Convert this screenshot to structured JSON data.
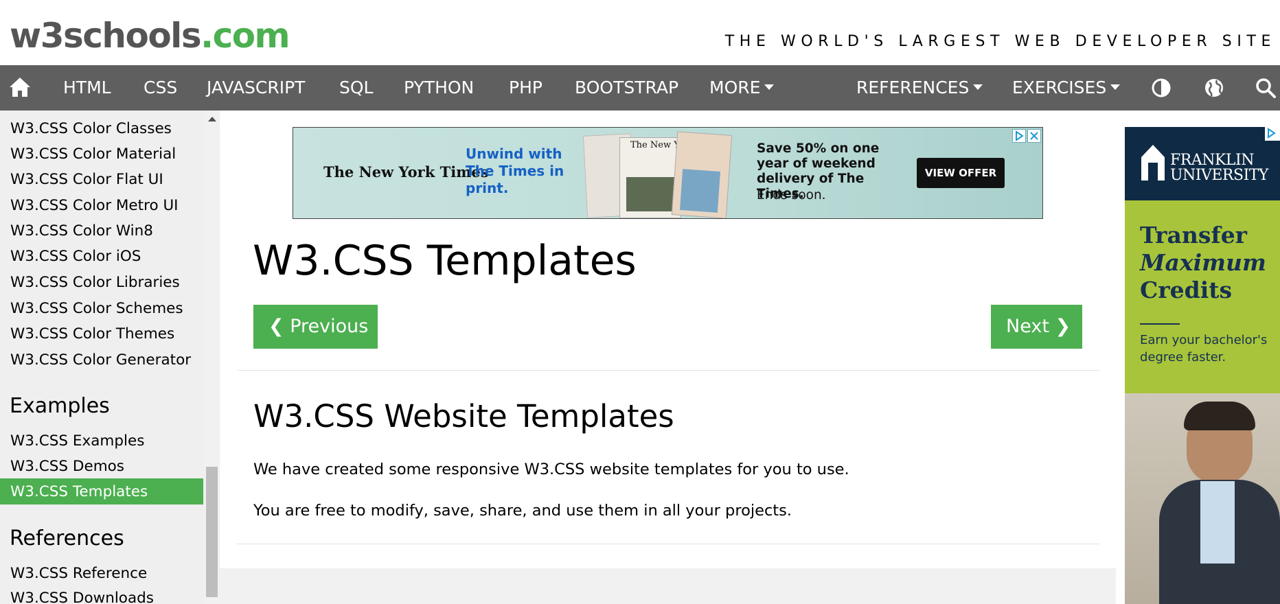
{
  "header": {
    "logo_main": "w3schools",
    "logo_tld": ".com",
    "tagline": "THE WORLD'S LARGEST WEB DEVELOPER SITE"
  },
  "nav": {
    "items": [
      "HTML",
      "CSS",
      "JAVASCRIPT",
      "SQL",
      "PYTHON",
      "PHP",
      "BOOTSTRAP",
      "MORE"
    ],
    "right_items": [
      "REFERENCES",
      "EXERCISES"
    ],
    "icons": [
      "home-icon",
      "contrast-icon",
      "globe-icon",
      "search-icon"
    ]
  },
  "sidebar": {
    "links_top": [
      "W3.CSS Color Classes",
      "W3.CSS Color Material",
      "W3.CSS Color Flat UI",
      "W3.CSS Color Metro UI",
      "W3.CSS Color Win8",
      "W3.CSS Color iOS",
      "W3.CSS Color Libraries",
      "W3.CSS Color Schemes",
      "W3.CSS Color Themes",
      "W3.CSS Color Generator"
    ],
    "examples_heading": "Examples",
    "examples": [
      "W3.CSS Examples",
      "W3.CSS Demos",
      "W3.CSS Templates"
    ],
    "references_heading": "References",
    "references": [
      "W3.CSS Reference",
      "W3.CSS Downloads"
    ]
  },
  "ad_top": {
    "brand": "The New York Times",
    "headline": "Unwind with The Times in print.",
    "offer": "Save 50% on one year of weekend delivery of The Times.",
    "subtext": "Ends soon.",
    "cta": "VIEW OFFER"
  },
  "main": {
    "title": "W3.CSS Templates",
    "prev_label": "❮ Previous",
    "next_label": "Next ❯",
    "subtitle": "W3.CSS Website Templates",
    "para1": "We have created some responsive W3.CSS website templates for you to use.",
    "para2": "You are free to modify, save, share, and use them in all your projects."
  },
  "ad_side": {
    "brand": "FRANKLIN UNIVERSITY",
    "line1": "Transfer",
    "line2": "Maximum",
    "line3": "Credits",
    "sub": "Earn your bachelor's degree faster."
  },
  "colors": {
    "accent": "#4caf50",
    "nav_bg": "#5f5f5f",
    "sidebar_bg": "#efefef"
  }
}
